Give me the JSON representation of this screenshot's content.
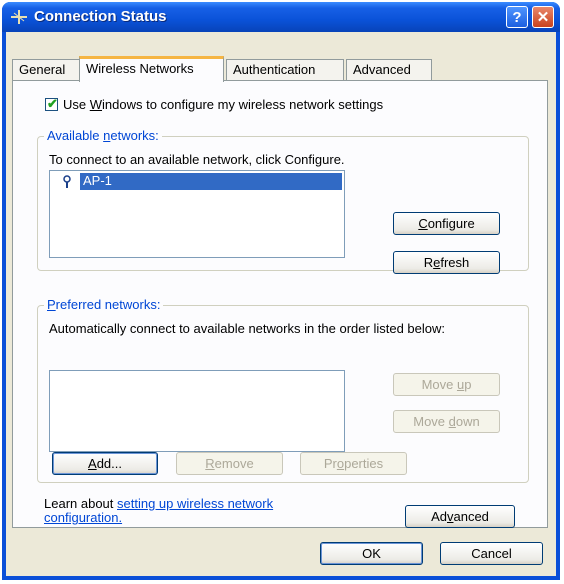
{
  "window": {
    "title": "Connection Status",
    "help_button": "?",
    "close_button": "✕"
  },
  "tabs": [
    {
      "label": "General"
    },
    {
      "label": "Wireless Networks"
    },
    {
      "label": "Authentication"
    },
    {
      "label": "Advanced"
    }
  ],
  "use_windows_checkbox": {
    "checked": true,
    "label_pre": "Use ",
    "label_accel": "W",
    "label_post": "indows to configure my wireless network settings"
  },
  "available": {
    "label_pre": "Available ",
    "label_accel": "n",
    "label_post": "etworks:",
    "instruction": "To connect to an available network, click Configure.",
    "networks": [
      {
        "name": "AP-1",
        "selected": true
      }
    ],
    "configure_accel": "C",
    "configure_rest": "onfigure",
    "refresh_pre": "R",
    "refresh_accel": "e",
    "refresh_post": "fresh"
  },
  "preferred": {
    "label_accel": "P",
    "label_post": "referred networks:",
    "instruction": "Automatically connect to available networks in the order listed below:",
    "move_up_pre": "Move ",
    "move_up_accel": "u",
    "move_up_post": "p",
    "move_down_pre": "Move ",
    "move_down_accel": "d",
    "move_down_post": "own",
    "add_accel": "A",
    "add_post": "dd...",
    "remove_accel": "R",
    "remove_post": "emove",
    "properties_pre": "Pr",
    "properties_accel": "o",
    "properties_post": "perties"
  },
  "learn": {
    "prefix": "Learn about ",
    "link_line1": "setting up wireless network",
    "link_line2": "configuration."
  },
  "advanced_button": {
    "pre": "Ad",
    "accel": "v",
    "post": "anced"
  },
  "footer": {
    "ok": "OK",
    "cancel": "Cancel"
  }
}
